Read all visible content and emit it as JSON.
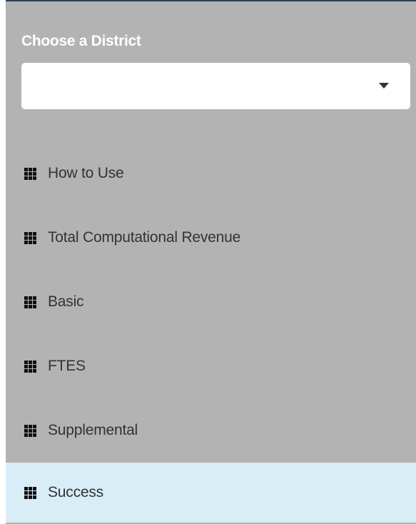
{
  "sidebar": {
    "district": {
      "label": "Choose a District",
      "selected_value": ""
    },
    "icon": "grid-icon",
    "items": [
      {
        "label": "How to Use",
        "active": false
      },
      {
        "label": "Total Computational Revenue",
        "active": false
      },
      {
        "label": "Basic",
        "active": false
      },
      {
        "label": "FTES",
        "active": false
      },
      {
        "label": "Supplemental",
        "active": false
      },
      {
        "label": "Success",
        "active": true
      }
    ]
  },
  "colors": {
    "sidebar_bg": "#b3b3b3",
    "active_bg": "#d9edf7",
    "top_border": "#2a3f54"
  }
}
